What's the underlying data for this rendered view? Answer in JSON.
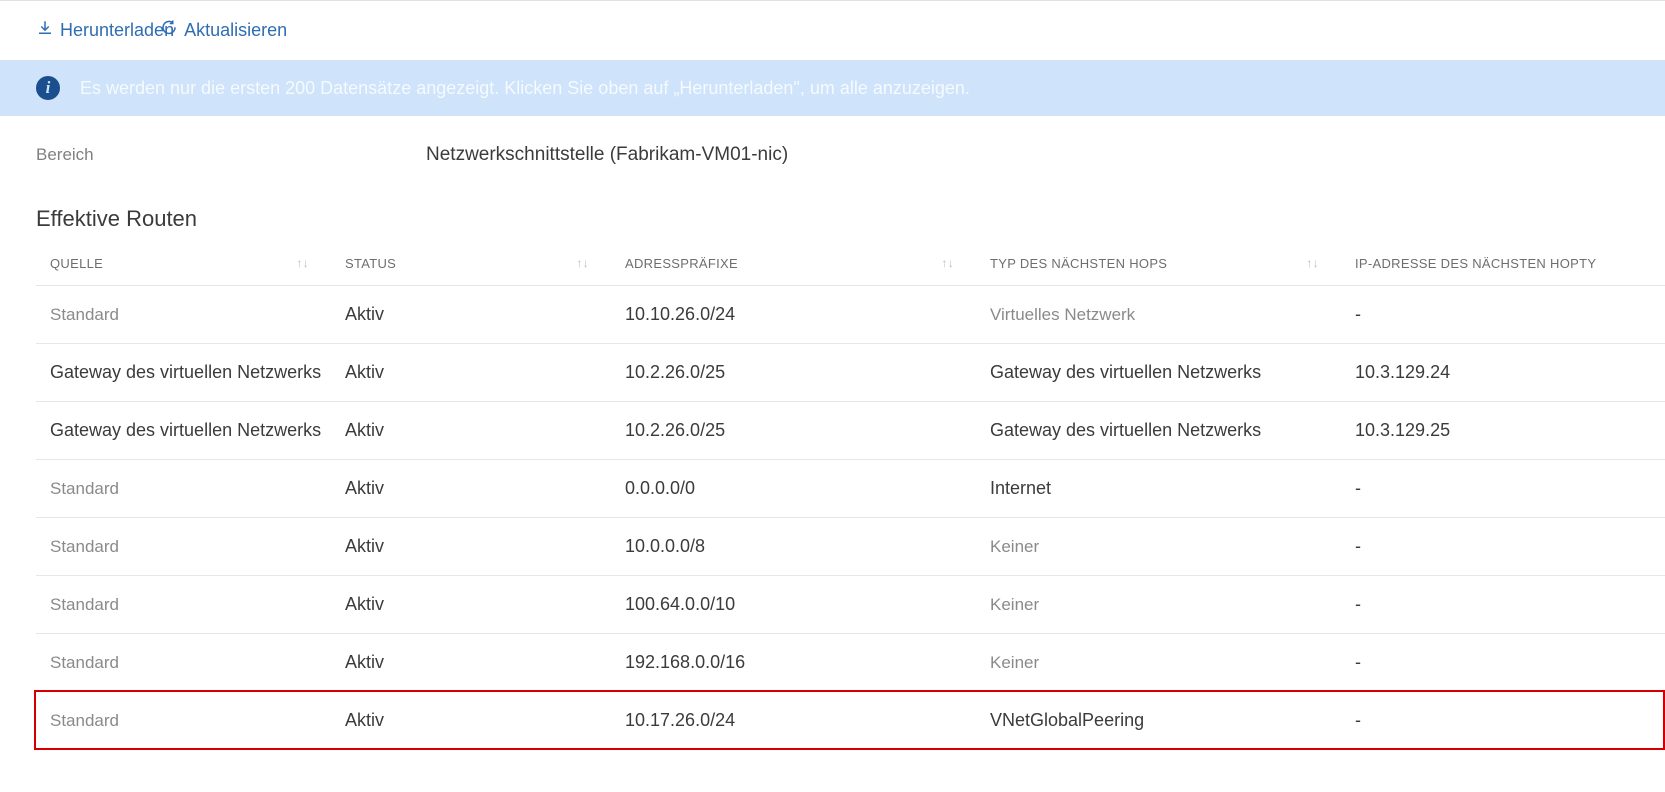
{
  "toolbar": {
    "download_label": "Herunterladen",
    "refresh_label": "Aktualisieren"
  },
  "info_banner": {
    "text": "Es werden nur die ersten 200 Datensätze angezeigt. Klicken Sie oben auf „Herunterladen\", um alle anzuzeigen."
  },
  "scope": {
    "label": "Bereich",
    "value": "Netzwerkschnittstelle (Fabrikam-VM01-nic)"
  },
  "section_title": "Effektive Routen",
  "columns": {
    "source": "QUELLE",
    "status": "STATUS",
    "prefix": "ADRESSPRÄFIXE",
    "nexthop_type": "TYP DES NÄCHSTEN HOPS",
    "nexthop_ip": "IP-ADRESSE DES NÄCHSTEN HOPTY"
  },
  "rows": [
    {
      "source": "Standard",
      "source_muted": true,
      "status": "Aktiv",
      "prefix": "10.10.26.0/24",
      "nexthop": "Virtuelles Netzwerk",
      "nexthop_muted": true,
      "ip": "-"
    },
    {
      "source": "Gateway des virtuellen Netzwerks",
      "source_muted": false,
      "status": "Aktiv",
      "prefix": "10.2.26.0/25",
      "nexthop": "Gateway des virtuellen Netzwerks",
      "nexthop_muted": false,
      "ip": "10.3.129.24"
    },
    {
      "source": "Gateway des virtuellen Netzwerks",
      "source_muted": false,
      "status": "Aktiv",
      "prefix": "10.2.26.0/25",
      "nexthop": "Gateway des virtuellen Netzwerks",
      "nexthop_muted": false,
      "ip": "10.3.129.25"
    },
    {
      "source": "Standard",
      "source_muted": true,
      "status": "Aktiv",
      "prefix": "0.0.0.0/0",
      "nexthop": "Internet",
      "nexthop_muted": false,
      "ip": "-"
    },
    {
      "source": "Standard",
      "source_muted": true,
      "status": "Aktiv",
      "prefix": "10.0.0.0/8",
      "nexthop": "Keiner",
      "nexthop_muted": true,
      "ip": "-"
    },
    {
      "source": "Standard",
      "source_muted": true,
      "status": "Aktiv",
      "prefix": "100.64.0.0/10",
      "nexthop": "Keiner",
      "nexthop_muted": true,
      "ip": "-"
    },
    {
      "source": "Standard",
      "source_muted": true,
      "status": "Aktiv",
      "prefix": "192.168.0.0/16",
      "nexthop": "Keiner",
      "nexthop_muted": true,
      "ip": "-"
    },
    {
      "source": "Standard",
      "source_muted": true,
      "status": "Aktiv",
      "prefix": "10.17.26.0/24",
      "nexthop": "VNetGlobalPeering",
      "nexthop_muted": false,
      "ip": "-",
      "highlighted": true
    }
  ]
}
